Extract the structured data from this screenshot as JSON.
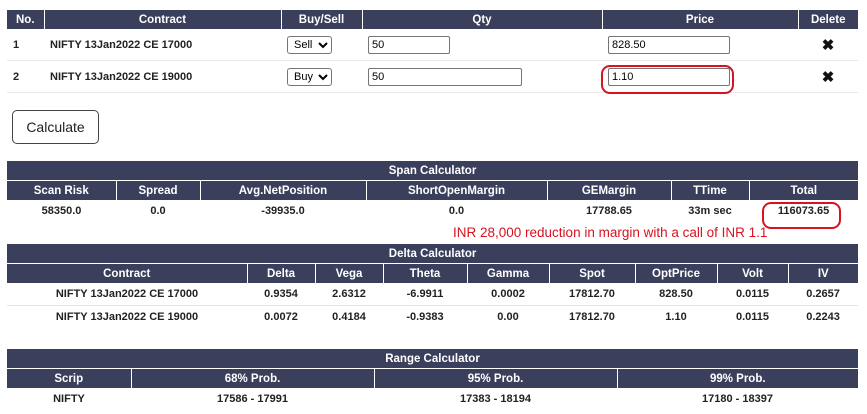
{
  "order_table": {
    "headers": [
      "No.",
      "Contract",
      "Buy/Sell",
      "Qty",
      "Price",
      "Delete"
    ],
    "rows": [
      {
        "no": "1",
        "contract": "NIFTY 13Jan2022 CE 17000",
        "side": "Sell",
        "qty": "50",
        "price": "828.50",
        "delete": "✖"
      },
      {
        "no": "2",
        "contract": "NIFTY 13Jan2022 CE 19000",
        "side": "Buy",
        "qty": "50",
        "price": "1.10",
        "delete": "✖"
      }
    ]
  },
  "calculate_label": "Calculate",
  "span": {
    "title": "Span Calculator",
    "headers": [
      "Scan Risk",
      "Spread",
      "Avg.NetPosition",
      "ShortOpenMargin",
      "GEMargin",
      "TTime",
      "Total"
    ],
    "values": [
      "58350.0",
      "0.0",
      "-39935.0",
      "0.0",
      "17788.65",
      "33m sec",
      "116073.65"
    ]
  },
  "annotation": "INR 28,000 reduction in margin with a call of INR 1.1",
  "delta": {
    "title": "Delta Calculator",
    "headers": [
      "Contract",
      "Delta",
      "Vega",
      "Theta",
      "Gamma",
      "Spot",
      "OptPrice",
      "Volt",
      "IV"
    ],
    "rows": [
      [
        "NIFTY 13Jan2022 CE 17000",
        "0.9354",
        "2.6312",
        "-6.9911",
        "0.0002",
        "17812.70",
        "828.50",
        "0.0115",
        "0.2657"
      ],
      [
        "NIFTY 13Jan2022 CE 19000",
        "0.0072",
        "0.4184",
        "-0.9383",
        "0.00",
        "17812.70",
        "1.10",
        "0.0115",
        "0.2243"
      ]
    ]
  },
  "range": {
    "title": "Range Calculator",
    "headers": [
      "Scrip",
      "68% Prob.",
      "95% Prob.",
      "99% Prob."
    ],
    "values": [
      "NIFTY",
      "17586 - 17991",
      "17383 - 18194",
      "17180 - 18397"
    ]
  },
  "colors": {
    "header_bg": "#3a3f5c",
    "highlight": "#d9121f"
  }
}
